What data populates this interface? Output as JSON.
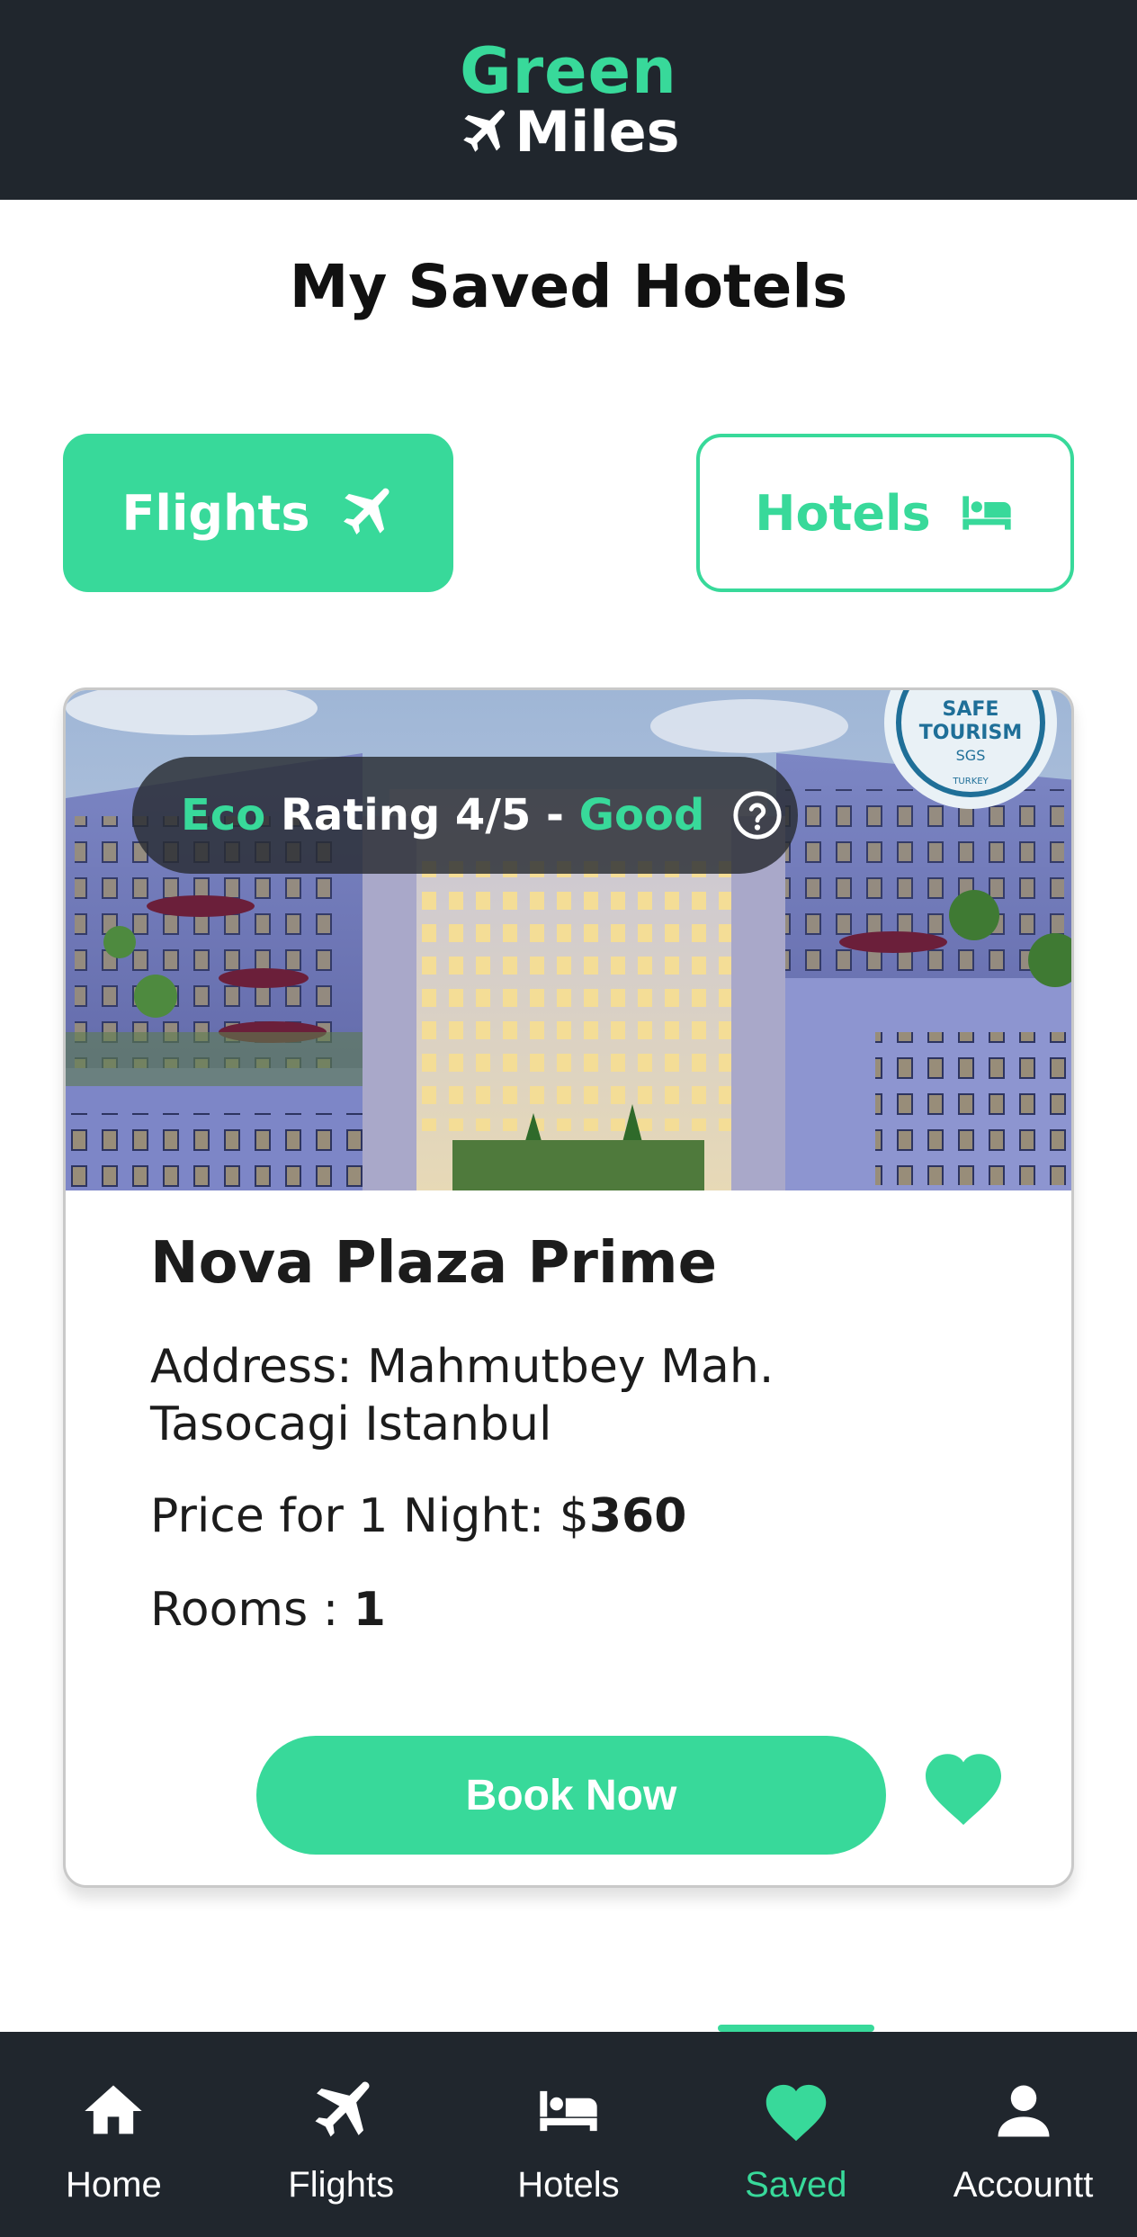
{
  "header": {
    "logo_line1": "Green",
    "logo_line2": "Miles"
  },
  "page": {
    "title": "My Saved Hotels"
  },
  "toggle": {
    "flights_label": "Flights",
    "hotels_label": "Hotels",
    "active": "flights"
  },
  "hotel_card": {
    "eco": {
      "word_eco": "Eco",
      "word_rating": "Rating 4/5 -",
      "word_good": "Good"
    },
    "name": "Nova Plaza Prime",
    "address_line1": "Address: Mahmutbey Mah.",
    "address_line2": "Tasocagi Istanbul",
    "price_label": "Price for 1 Night: $",
    "price_value": "360",
    "rooms_label": "Rooms : ",
    "rooms_value": "1",
    "book_label": "Book Now",
    "favorited": true,
    "image_stamp": {
      "line1": "SAFE",
      "line2": "TOURISM",
      "line3": "SGS",
      "line4": "TURKEY"
    }
  },
  "nav": {
    "items": [
      {
        "label": "Home",
        "icon": "home-icon"
      },
      {
        "label": "Flights",
        "icon": "plane-icon"
      },
      {
        "label": "Hotels",
        "icon": "bed-icon"
      },
      {
        "label": "Saved",
        "icon": "heart-icon",
        "active": true
      },
      {
        "label": "Accountt",
        "icon": "person-icon"
      }
    ]
  },
  "colors": {
    "accent": "#38d99a",
    "dark": "#20262d"
  }
}
